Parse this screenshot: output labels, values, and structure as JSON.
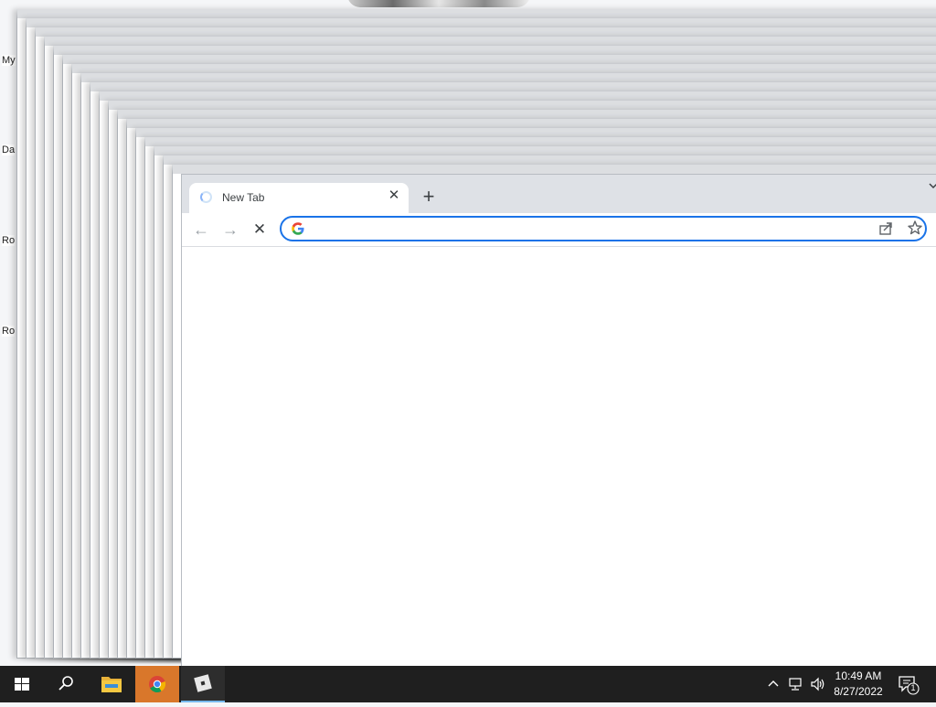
{
  "desktop": {
    "icon_labels": [
      "My",
      "Da",
      "Ro",
      "Ro"
    ]
  },
  "browser": {
    "tab_title": "New Tab",
    "close_glyph": "✕",
    "new_tab_glyph": "+",
    "back_glyph": "←",
    "forward_glyph": "→",
    "stop_glyph": "✕",
    "omnibox_value": "",
    "omnibox_placeholder": ""
  },
  "taskbar": {
    "time": "10:49 AM",
    "date": "8/27/2022",
    "notification_count": "1",
    "apps": [
      "start",
      "search",
      "file-explorer",
      "chrome",
      "roblox"
    ]
  },
  "colors": {
    "accent": "#1a73e8",
    "taskbar": "#1f1f1f",
    "chrome_active": "#d9772b",
    "tab_strip": "#dee1e6"
  }
}
